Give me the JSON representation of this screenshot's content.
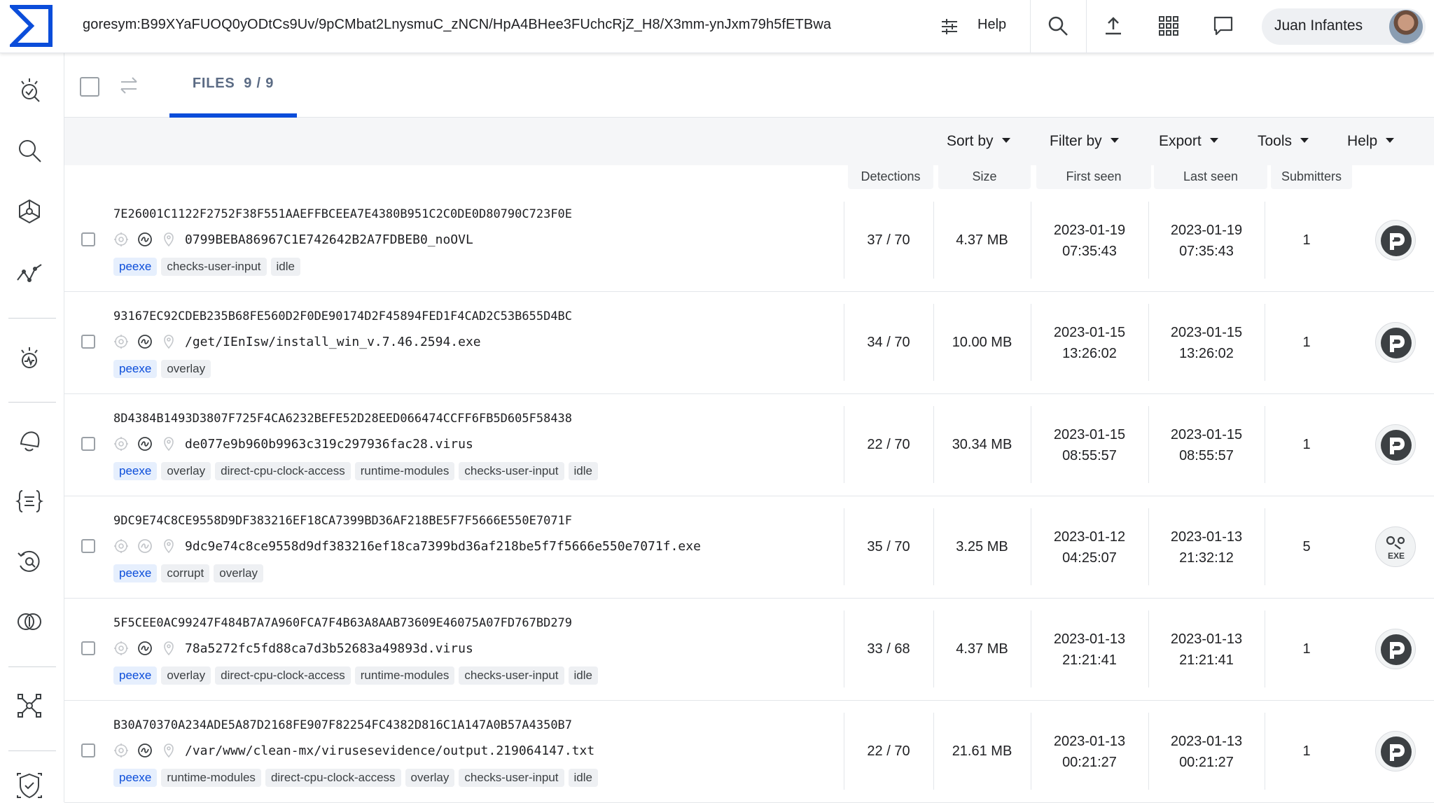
{
  "topbar": {
    "search_query": "goresym:B99XYaFUOQ0yODtCs9Uv/9pCMbat2LnysmuC_zNCN/HpA4BHee3FUchcRjZ_H8/X3mm-ynJxm79h5fETBwa",
    "help_label": "Help",
    "user_name": "Juan Infantes"
  },
  "files_tab": {
    "label": "FILES",
    "count": "9 / 9"
  },
  "toolbar": {
    "sort_by": "Sort by",
    "filter_by": "Filter by",
    "export": "Export",
    "tools": "Tools",
    "help": "Help"
  },
  "columns": {
    "detections": "Detections",
    "size": "Size",
    "first_seen": "First seen",
    "last_seen": "Last seen",
    "submitters": "Submitters"
  },
  "rows": [
    {
      "hash": "7E26001C1122F2752F38F551AAEFFBCEEA7E4380B951C2C0DE0D80790C723F0E",
      "filename": "0799BEBA86967C1E742642B2A7FDBEB0_noOVL",
      "tags": [
        "peexe",
        "checks-user-input",
        "idle"
      ],
      "detections": "37 / 70",
      "size": "4.37 MB",
      "first_seen_date": "2023-01-19",
      "first_seen_time": "07:35:43",
      "last_seen_date": "2023-01-19",
      "last_seen_time": "07:35:43",
      "submitters": "1",
      "file_type_icon": "pe-icon"
    },
    {
      "hash": "93167EC92CDEB235B68FE560D2F0DE90174D2F45894FED1F4CAD2C53B655D4BC",
      "filename": "/get/IEnIsw/install_win_v.7.46.2594.exe",
      "tags": [
        "peexe",
        "overlay"
      ],
      "detections": "34 / 70",
      "size": "10.00 MB",
      "first_seen_date": "2023-01-15",
      "first_seen_time": "13:26:02",
      "last_seen_date": "2023-01-15",
      "last_seen_time": "13:26:02",
      "submitters": "1",
      "file_type_icon": "pe-icon"
    },
    {
      "hash": "8D4384B1493D3807F725F4CA6232BEFE52D28EED066474CCFF6FB5D605F58438",
      "filename": "de077e9b960b9963c319c297936fac28.virus",
      "tags": [
        "peexe",
        "overlay",
        "direct-cpu-clock-access",
        "runtime-modules",
        "checks-user-input",
        "idle"
      ],
      "detections": "22 / 70",
      "size": "30.34 MB",
      "first_seen_date": "2023-01-15",
      "first_seen_time": "08:55:57",
      "last_seen_date": "2023-01-15",
      "last_seen_time": "08:55:57",
      "submitters": "1",
      "file_type_icon": "pe-icon"
    },
    {
      "hash": "9DC9E74C8CE9558D9DF383216EF18CA7399BD36AF218BE5F7F5666E550E7071F",
      "filename": "9dc9e74c8ce9558d9df383216ef18ca7399bd36af218be5f7f5666e550e7071f.exe",
      "tags": [
        "peexe",
        "corrupt",
        "overlay"
      ],
      "detections": "35 / 70",
      "size": "3.25 MB",
      "first_seen_date": "2023-01-12",
      "first_seen_time": "04:25:07",
      "last_seen_date": "2023-01-13",
      "last_seen_time": "21:32:12",
      "submitters": "5",
      "file_type_icon": "exe-icon",
      "file_type_label": "EXE"
    },
    {
      "hash": "5F5CEE0AC99247F484B7A7A960FCA7F4B63A8AAB73609E46075A07FD767BD279",
      "filename": "78a5272fc5fd88ca7d3b52683a49893d.virus",
      "tags": [
        "peexe",
        "overlay",
        "direct-cpu-clock-access",
        "runtime-modules",
        "checks-user-input",
        "idle"
      ],
      "detections": "33 / 68",
      "size": "4.37 MB",
      "first_seen_date": "2023-01-13",
      "first_seen_time": "21:21:41",
      "last_seen_date": "2023-01-13",
      "last_seen_time": "21:21:41",
      "submitters": "1",
      "file_type_icon": "pe-icon"
    },
    {
      "hash": "B30A70370A234ADE5A87D2168FE907F82254FC4382D816C1A147A0B57A4350B7",
      "filename": "/var/www/clean-mx/virusesevidence/output.219064147.txt",
      "tags": [
        "peexe",
        "runtime-modules",
        "direct-cpu-clock-access",
        "overlay",
        "checks-user-input",
        "idle"
      ],
      "detections": "22 / 70",
      "size": "21.61 MB",
      "first_seen_date": "2023-01-13",
      "first_seen_time": "00:21:27",
      "last_seen_date": "2023-01-13",
      "last_seen_time": "00:21:27",
      "submitters": "1",
      "file_type_icon": "pe-icon"
    }
  ],
  "colors": {
    "brand": "#0b4dda",
    "tag_blue_bg": "#e6effd",
    "tag_gray_bg": "#eef0f3",
    "toolbar_bg": "#f5f6f8"
  }
}
